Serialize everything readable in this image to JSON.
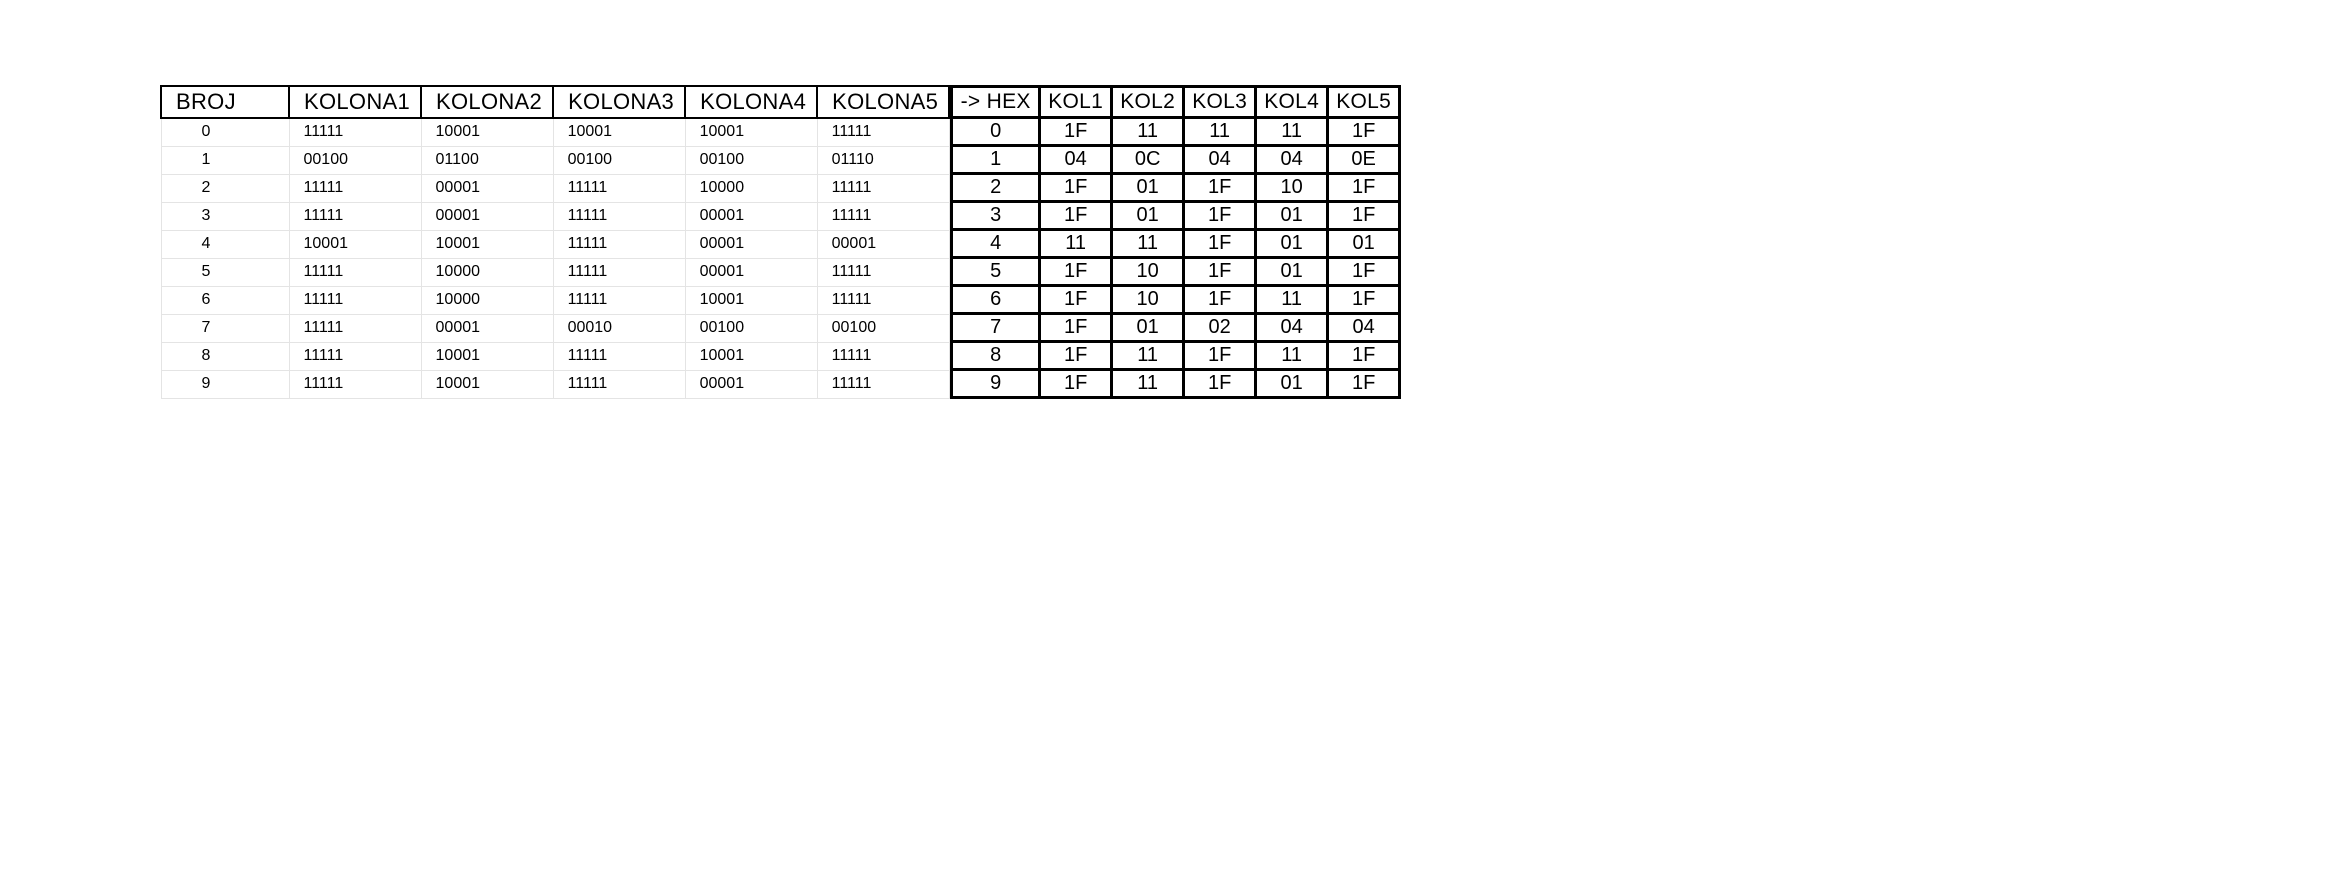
{
  "left_table": {
    "headers": [
      "BROJ",
      "KOLONA1",
      "KOLONA2",
      "KOLONA3",
      "KOLONA4",
      "KOLONA5"
    ],
    "rows": [
      {
        "broj": "0",
        "k": [
          "11111",
          "10001",
          "10001",
          "10001",
          "11111"
        ]
      },
      {
        "broj": "1",
        "k": [
          "00100",
          "01100",
          "00100",
          "00100",
          "01110"
        ]
      },
      {
        "broj": "2",
        "k": [
          "11111",
          "00001",
          "11111",
          "10000",
          "11111"
        ]
      },
      {
        "broj": "3",
        "k": [
          "11111",
          "00001",
          "11111",
          "00001",
          "11111"
        ]
      },
      {
        "broj": "4",
        "k": [
          "10001",
          "10001",
          "11111",
          "00001",
          "00001"
        ]
      },
      {
        "broj": "5",
        "k": [
          "11111",
          "10000",
          "11111",
          "00001",
          "11111"
        ]
      },
      {
        "broj": "6",
        "k": [
          "11111",
          "10000",
          "11111",
          "10001",
          "11111"
        ]
      },
      {
        "broj": "7",
        "k": [
          "11111",
          "00001",
          "00010",
          "00100",
          "00100"
        ]
      },
      {
        "broj": "8",
        "k": [
          "11111",
          "10001",
          "11111",
          "10001",
          "11111"
        ]
      },
      {
        "broj": "9",
        "k": [
          "11111",
          "10001",
          "11111",
          "00001",
          "11111"
        ]
      }
    ]
  },
  "right_table": {
    "headers": [
      "->  HEX",
      "KOL1",
      "KOL2",
      "KOL3",
      "KOL4",
      "KOL5"
    ],
    "rows": [
      {
        "hex": "0",
        "k": [
          "1F",
          "11",
          "11",
          "11",
          "1F"
        ]
      },
      {
        "hex": "1",
        "k": [
          "04",
          "0C",
          "04",
          "04",
          "0E"
        ]
      },
      {
        "hex": "2",
        "k": [
          "1F",
          "01",
          "1F",
          "10",
          "1F"
        ]
      },
      {
        "hex": "3",
        "k": [
          "1F",
          "01",
          "1F",
          "01",
          "1F"
        ]
      },
      {
        "hex": "4",
        "k": [
          "11",
          "11",
          "1F",
          "01",
          "01"
        ]
      },
      {
        "hex": "5",
        "k": [
          "1F",
          "10",
          "1F",
          "01",
          "1F"
        ]
      },
      {
        "hex": "6",
        "k": [
          "1F",
          "10",
          "1F",
          "11",
          "1F"
        ]
      },
      {
        "hex": "7",
        "k": [
          "1F",
          "01",
          "02",
          "04",
          "04"
        ]
      },
      {
        "hex": "8",
        "k": [
          "1F",
          "11",
          "1F",
          "11",
          "1F"
        ]
      },
      {
        "hex": "9",
        "k": [
          "1F",
          "11",
          "1F",
          "01",
          "1F"
        ]
      }
    ]
  }
}
